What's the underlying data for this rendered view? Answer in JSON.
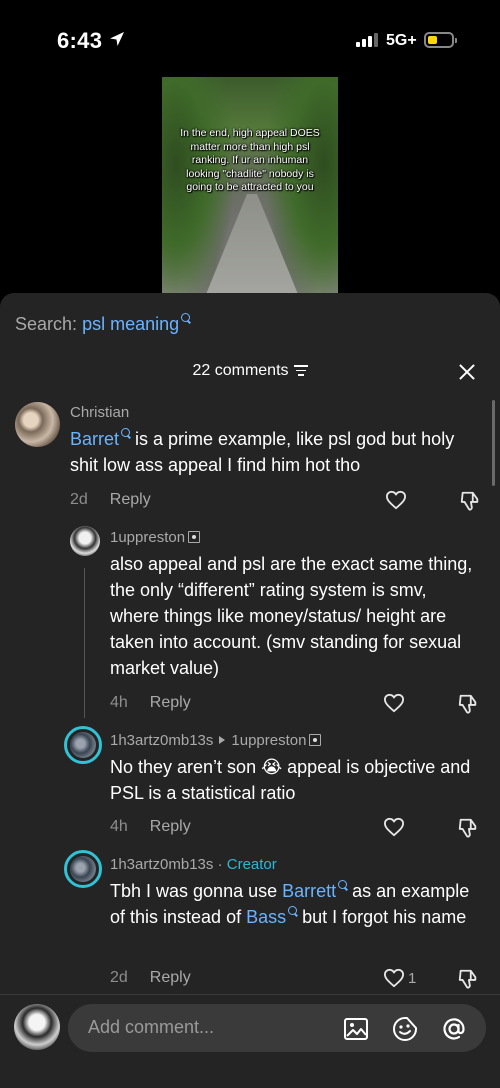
{
  "status_bar": {
    "time": "6:43",
    "network": "5G+"
  },
  "video": {
    "caption": "In the end, high appeal DOES matter more than high psl ranking. If ur an inhuman looking \"chadlite\" nobody is going to be attracted to you"
  },
  "search": {
    "prefix": "Search:",
    "query": "psl meaning"
  },
  "comments_header": {
    "count_label": "22 comments"
  },
  "comments": [
    {
      "username": "Christian",
      "mention": "Barret",
      "text": " is a prime example, like psl god but holy shit low ass appeal I find him hot tho",
      "age": "2d",
      "reply_label": "Reply"
    },
    {
      "username": "1uppreston",
      "text": "also appeal and psl are the exact same thing, the only “different” rating system is smv, where things like money/status/ height are taken into account. (smv standing for sexual market value)",
      "age": "4h",
      "reply_label": "Reply"
    },
    {
      "username": "1h3artz0mb13s",
      "reply_to": "1uppreston",
      "text_before": "No they aren’t son",
      "emoji": "😭",
      "text_after": " appeal is objective and PSL is a statistical ratio",
      "age": "4h",
      "reply_label": "Reply"
    },
    {
      "username": "1h3artz0mb13s",
      "separator": "·",
      "badge": "Creator",
      "text_1": "Tbh I was gonna use ",
      "mention_1": "Barrett",
      "text_2": " as an example of this instead of ",
      "mention_2": "Bass",
      "text_3": " but I forgot his name",
      "age": "2d",
      "reply_label": "Reply",
      "likes": "1"
    }
  ],
  "composer": {
    "placeholder": "Add comment..."
  },
  "colors": {
    "accent_blue": "#6bb3ff",
    "creator_teal": "#30b8d3",
    "sheet_bg": "#242424"
  },
  "icons": [
    "location-arrow-icon",
    "signal-icon",
    "battery-icon",
    "search-icon",
    "filter-icon",
    "close-icon",
    "heart-icon",
    "dislike-icon",
    "image-icon",
    "emoji-icon",
    "mention-icon"
  ]
}
